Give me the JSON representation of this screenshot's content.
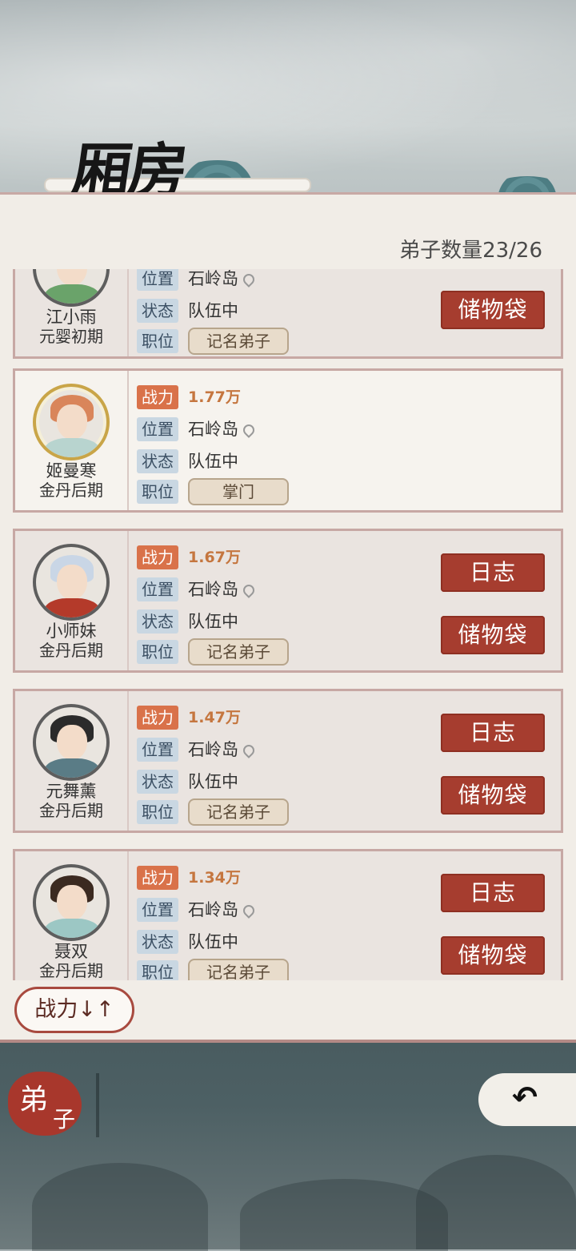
{
  "header": {
    "title": "厢房",
    "disciple_count": "弟子数量23/26"
  },
  "labels": {
    "power": "战力",
    "location": "位置",
    "status": "状态",
    "position": "职位"
  },
  "buttons": {
    "log": "日志",
    "storage": "储物袋"
  },
  "disciples": [
    {
      "name": "江小雨",
      "realm": "元婴初期",
      "power": "",
      "location": "石岭岛",
      "status": "队伍中",
      "rank": "记名弟子"
    },
    {
      "name": "姬曼寒",
      "realm": "金丹后期",
      "power": "1.77万",
      "location": "石岭岛",
      "status": "队伍中",
      "rank": "掌门"
    },
    {
      "name": "小师妹",
      "realm": "金丹后期",
      "power": "1.67万",
      "location": "石岭岛",
      "status": "队伍中",
      "rank": "记名弟子"
    },
    {
      "name": "元舞薰",
      "realm": "金丹后期",
      "power": "1.47万",
      "location": "石岭岛",
      "status": "队伍中",
      "rank": "记名弟子"
    },
    {
      "name": "聂双",
      "realm": "金丹后期",
      "power": "1.34万",
      "location": "石岭岛",
      "status": "队伍中",
      "rank": "记名弟子"
    }
  ],
  "sort": {
    "label": "战力↓↑"
  },
  "bottom_nav": {
    "tab_char1": "弟",
    "tab_char2": "子",
    "back_icon": "back-arrow-icon",
    "back_glyph": "↶"
  },
  "colors": {
    "accent_red": "#a63d2f",
    "power_orange": "#d9724a",
    "panel_bg": "#f1ede7"
  }
}
